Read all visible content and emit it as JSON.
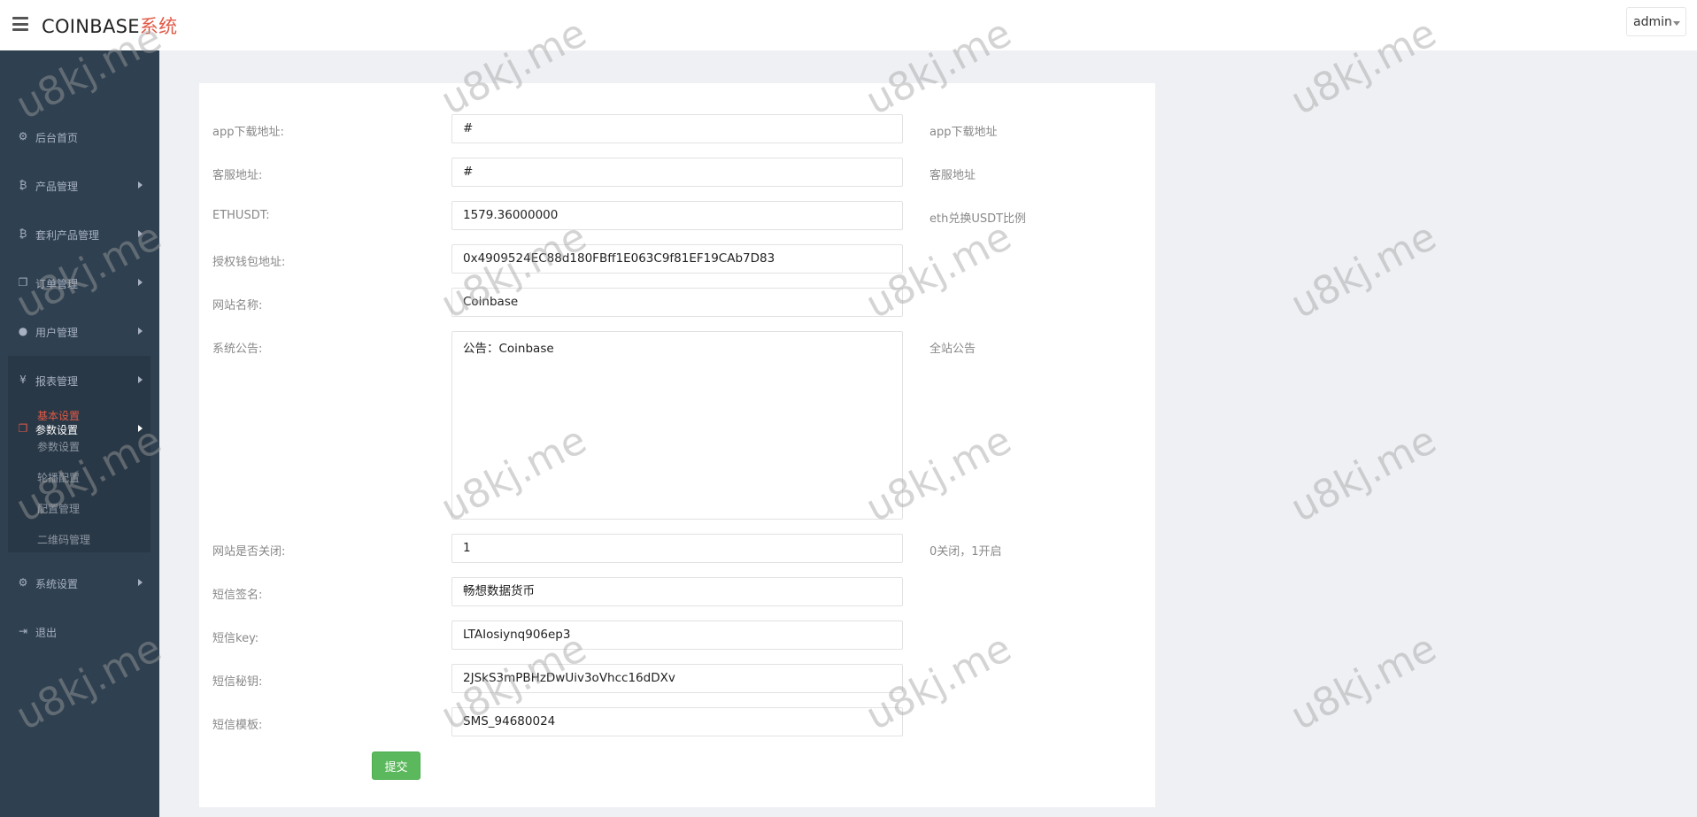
{
  "header": {
    "brand_main": "COINBASE",
    "brand_suffix": "系统",
    "user": "admin"
  },
  "sidebar": {
    "items": [
      {
        "label": "后台首页",
        "icon": "dashboard-icon"
      },
      {
        "label": "产品管理",
        "icon": "bitcoin-icon"
      },
      {
        "label": "套利产品管理",
        "icon": "bitcoin-icon"
      },
      {
        "label": "订单管理",
        "icon": "copy-icon"
      },
      {
        "label": "用户管理",
        "icon": "user-icon"
      },
      {
        "label": "报表管理",
        "icon": "yen-icon"
      },
      {
        "label": "参数设置",
        "icon": "files-icon"
      },
      {
        "label": "系统设置",
        "icon": "gears-icon"
      },
      {
        "label": "退出",
        "icon": "sign-out-icon"
      }
    ],
    "subitems": [
      {
        "label": "基本设置",
        "active": true
      },
      {
        "label": "参数设置",
        "active": false
      },
      {
        "label": "轮播配置",
        "active": false
      },
      {
        "label": "配置管理",
        "active": false
      },
      {
        "label": "二维码管理",
        "active": false
      }
    ]
  },
  "form": {
    "rows": [
      {
        "label": "app下载地址:",
        "value": "#",
        "help": "app下载地址"
      },
      {
        "label": "客服地址:",
        "value": "#",
        "help": "客服地址"
      },
      {
        "label": "ETHUSDT:",
        "value": "1579.36000000",
        "help": "eth兑换USDT比例"
      },
      {
        "label": "授权钱包地址:",
        "value": "0x4909524EC88d180FBff1E063C9f81EF19CAb7D83",
        "help": ""
      },
      {
        "label": "网站名称:",
        "value": "Coinbase",
        "help": ""
      },
      {
        "label": "系统公告:",
        "value": "公告：Coinbase",
        "help": "全站公告"
      },
      {
        "label": "网站是否关闭:",
        "value": "1",
        "help": "0关闭，1开启"
      },
      {
        "label": "短信签名:",
        "value": "畅想数据货币",
        "help": ""
      },
      {
        "label": "短信key:",
        "value": "LTAIosiynq906ep3",
        "help": ""
      },
      {
        "label": "短信秘钥:",
        "value": "2JSkS3mPBHzDwUiv3oVhcc16dDXv",
        "help": ""
      },
      {
        "label": "短信模板:",
        "value": "SMS_94680024",
        "help": ""
      }
    ],
    "submit_label": "提交"
  },
  "watermark": "u8kj.me",
  "colors": {
    "sidebar": "#2f4050",
    "accent": "#e05a47",
    "submit": "#5cb85c"
  }
}
